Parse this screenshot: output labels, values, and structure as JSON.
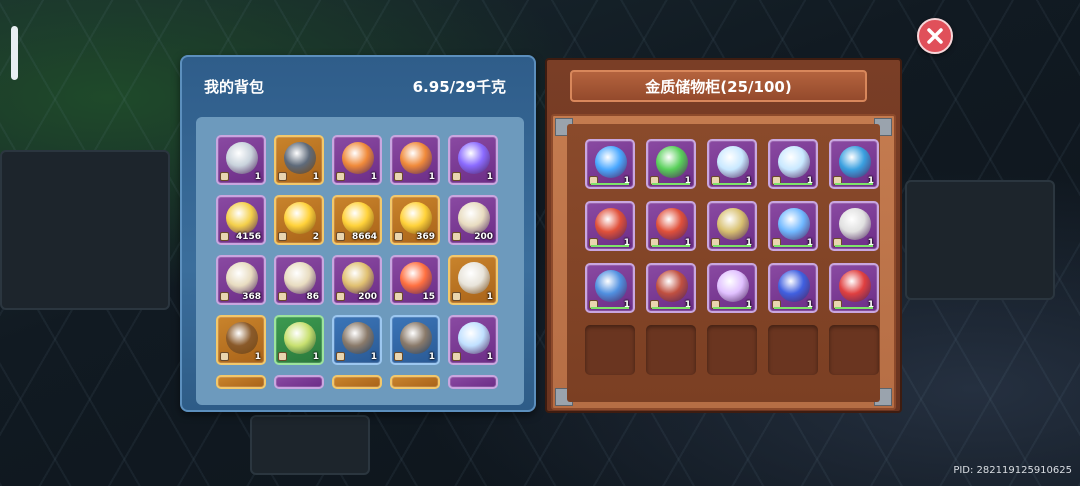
{
  "bag": {
    "title": "我的背包",
    "weight": "6.95/29千克",
    "items": [
      {
        "icon": "axe-icon",
        "qty": "1",
        "style": "purple",
        "art": "#c9d3dc"
      },
      {
        "icon": "gun-icon",
        "qty": "1",
        "style": "gold",
        "art": "#5e6a7a"
      },
      {
        "icon": "flame-emblem-icon",
        "qty": "1",
        "style": "purple",
        "art": "#f08a3a"
      },
      {
        "icon": "flame-emblem-icon",
        "qty": "1",
        "style": "purple",
        "art": "#f08a3a"
      },
      {
        "icon": "crystal-emblem-icon",
        "qty": "1",
        "style": "purple",
        "art": "#8b6bff"
      },
      {
        "icon": "shirt-icon",
        "qty": "4156",
        "style": "purple",
        "art": "#f4d04a"
      },
      {
        "icon": "gold-coin-icon",
        "qty": "2",
        "style": "gold",
        "art": "#ffd23a"
      },
      {
        "icon": "gold-coin-icon",
        "qty": "8664",
        "style": "gold",
        "art": "#ffd23a"
      },
      {
        "icon": "skull-coin-icon",
        "qty": "369",
        "style": "gold",
        "art": "#ffd23a"
      },
      {
        "icon": "scroll-icon",
        "qty": "200",
        "style": "purple",
        "art": "#e8dcc0"
      },
      {
        "icon": "scroll-icon",
        "qty": "368",
        "style": "purple",
        "art": "#e8dcc0"
      },
      {
        "icon": "scroll-icon",
        "qty": "86",
        "style": "purple",
        "art": "#e8dcc0"
      },
      {
        "icon": "rocket-icon",
        "qty": "200",
        "style": "purple",
        "art": "#e0c070"
      },
      {
        "icon": "fire-orb-icon",
        "qty": "15",
        "style": "purple",
        "art": "#ff7040"
      },
      {
        "icon": "horn-icon",
        "qty": "1",
        "style": "gold",
        "art": "#e8e4da"
      },
      {
        "icon": "treasure-chest-icon",
        "qty": "1",
        "style": "gold",
        "art": "#8a5a2a"
      },
      {
        "icon": "map-scroll-icon",
        "qty": "1",
        "style": "green",
        "art": "#c8e070"
      },
      {
        "icon": "storage-box-icon",
        "qty": "1",
        "style": "blue",
        "art": "#8a7a6a"
      },
      {
        "icon": "storage-box-icon",
        "qty": "1",
        "style": "blue",
        "art": "#8a7a6a"
      },
      {
        "icon": "stained-window-icon",
        "qty": "1",
        "style": "purple",
        "art": "#c0e0ff"
      }
    ],
    "partial_row": [
      {
        "icon": "partial-item-icon",
        "style": "gold"
      },
      {
        "icon": "partial-item-icon",
        "style": "purple"
      },
      {
        "icon": "partial-item-icon",
        "style": "gold"
      },
      {
        "icon": "partial-item-icon",
        "style": "gold"
      },
      {
        "icon": "partial-item-icon",
        "style": "purple"
      }
    ]
  },
  "locker": {
    "title": "金质储物柜(25/100)",
    "items": [
      {
        "icon": "blue-staff-icon",
        "qty": "1",
        "art": "#4aa8ff"
      },
      {
        "icon": "clover-wand-icon",
        "qty": "1",
        "art": "#58d05a"
      },
      {
        "icon": "potion-bottle-icon",
        "qty": "1",
        "art": "#c8e8ff"
      },
      {
        "icon": "potion-bottle-icon",
        "qty": "1",
        "art": "#c8e8ff"
      },
      {
        "icon": "blue-flask-icon",
        "qty": "1",
        "art": "#3aa0e0"
      },
      {
        "icon": "firework-icon",
        "qty": "1",
        "art": "#e0503a"
      },
      {
        "icon": "firework-icon",
        "qty": "1",
        "art": "#e0503a"
      },
      {
        "icon": "fishing-rod-icon",
        "qty": "1",
        "art": "#d8c070"
      },
      {
        "icon": "shell-icon",
        "qty": "1",
        "art": "#70b8ff"
      },
      {
        "icon": "spear-icon",
        "qty": "1",
        "art": "#e0e0e0"
      },
      {
        "icon": "bow-icon",
        "qty": "1",
        "art": "#5090e0"
      },
      {
        "icon": "slingshot-icon",
        "qty": "1",
        "art": "#c05040"
      },
      {
        "icon": "magic-wand-icon",
        "qty": "1",
        "art": "#e0c0ff"
      },
      {
        "icon": "blue-potion-icon",
        "qty": "1",
        "art": "#4060e0"
      },
      {
        "icon": "red-staff-icon",
        "qty": "1",
        "art": "#e04040"
      }
    ],
    "empty_slots": 5
  },
  "pid": "PID: 282119125910625"
}
